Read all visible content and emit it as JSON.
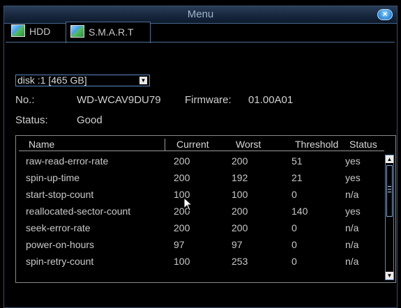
{
  "window": {
    "title": "Menu",
    "close_icon": "close-icon"
  },
  "tabs": [
    {
      "label": "HDD",
      "icon": "disk-icon"
    },
    {
      "label": "S.M.A.R.T",
      "icon": "disk-icon"
    }
  ],
  "disk_select": {
    "value": "disk :1 [465 GB]",
    "arrow_icon": "chevron-down-icon"
  },
  "info": {
    "no_label": "No.:",
    "no_value": "WD-WCAV9DU79",
    "firmware_label": "Firmware:",
    "firmware_value": "01.00A01",
    "status_label": "Status:",
    "status_value": "Good"
  },
  "table": {
    "columns": [
      "Name",
      "Current",
      "Worst",
      "Threshold",
      "Status"
    ],
    "rows": [
      {
        "name": "raw-read-error-rate",
        "current": "200",
        "worst": "200",
        "threshold": "51",
        "status": "yes"
      },
      {
        "name": "spin-up-time",
        "current": "200",
        "worst": "192",
        "threshold": "21",
        "status": "yes"
      },
      {
        "name": "start-stop-count",
        "current": "100",
        "worst": "100",
        "threshold": "0",
        "status": "n/a"
      },
      {
        "name": "reallocated-sector-count",
        "current": "200",
        "worst": "200",
        "threshold": "140",
        "status": "yes"
      },
      {
        "name": "seek-error-rate",
        "current": "200",
        "worst": "200",
        "threshold": "0",
        "status": "n/a"
      },
      {
        "name": "power-on-hours",
        "current": "97",
        "worst": "97",
        "threshold": "0",
        "status": "n/a"
      },
      {
        "name": "spin-retry-count",
        "current": "100",
        "worst": "253",
        "threshold": "0",
        "status": "n/a"
      }
    ]
  },
  "colors": {
    "accent": "#5a87c4",
    "background": "#000000",
    "text": "#d8d8d8"
  }
}
